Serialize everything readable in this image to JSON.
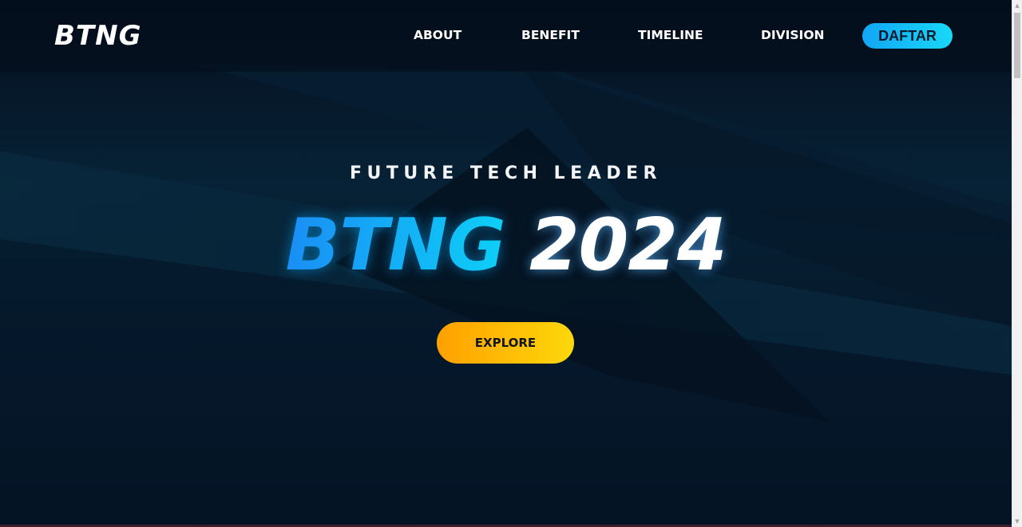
{
  "navbar": {
    "logo": "BTNG",
    "links": [
      "ABOUT",
      "BENEFIT",
      "TIMELINE",
      "DIVISION"
    ],
    "cta": "DAFTAR"
  },
  "hero": {
    "subtitle": "FUTURE TECH LEADER",
    "headline_brand": "BTNG",
    "headline_year": "2024",
    "explore": "EXPLORE"
  },
  "colors": {
    "background": "#061424",
    "accent_blue": "#12a6f6",
    "accent_cyan": "#18d8f6",
    "accent_orange": "#fea000",
    "accent_yellow": "#fdd80b"
  },
  "icons": {
    "scroll_up": "chevron-up-icon",
    "scroll_down": "chevron-down-icon"
  }
}
